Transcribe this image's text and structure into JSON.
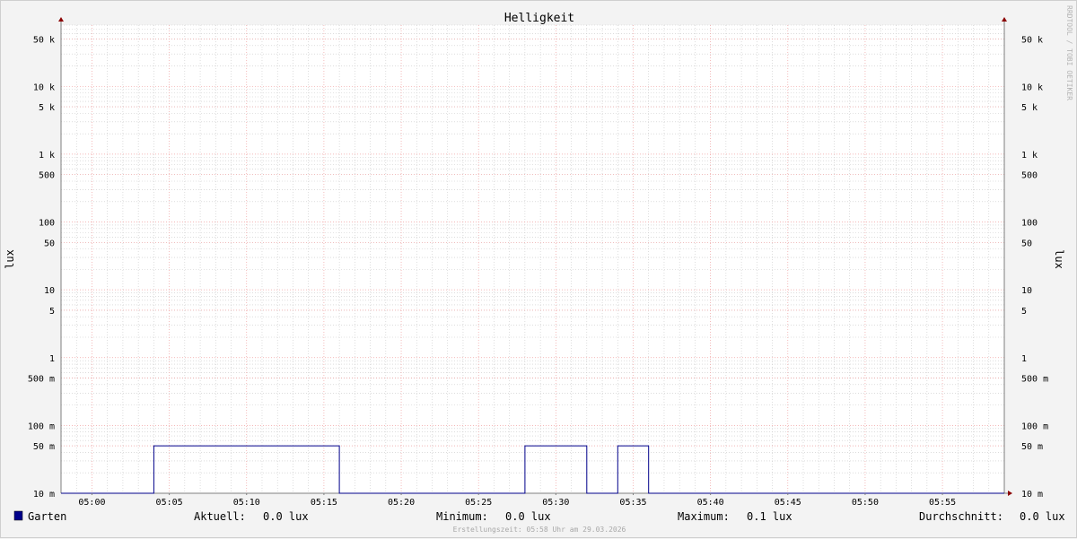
{
  "chart_data": {
    "type": "line",
    "title": "Helligkeit",
    "ylabel": "lux",
    "ylabel_right": "lux",
    "y_scale": "log",
    "ylim": [
      0.01,
      80000
    ],
    "xlim": [
      "04:58",
      "05:59"
    ],
    "x_ticks": [
      "05:00",
      "05:05",
      "05:10",
      "05:15",
      "05:20",
      "05:25",
      "05:30",
      "05:35",
      "05:40",
      "05:45",
      "05:50",
      "05:55"
    ],
    "y_ticks": [
      {
        "value": 50000,
        "label": "50 k"
      },
      {
        "value": 10000,
        "label": "10 k"
      },
      {
        "value": 5000,
        "label": "5 k"
      },
      {
        "value": 1000,
        "label": "1 k"
      },
      {
        "value": 500,
        "label": "500"
      },
      {
        "value": 100,
        "label": "100"
      },
      {
        "value": 50,
        "label": "50"
      },
      {
        "value": 10,
        "label": "10"
      },
      {
        "value": 5,
        "label": "5"
      },
      {
        "value": 1,
        "label": "1"
      },
      {
        "value": 0.5,
        "label": "500 m"
      },
      {
        "value": 0.1,
        "label": "100 m"
      },
      {
        "value": 0.05,
        "label": "50 m"
      },
      {
        "value": 0.01,
        "label": "10 m"
      }
    ],
    "grid": true,
    "series": [
      {
        "name": "Garten",
        "color": "#00008b",
        "points": [
          [
            "04:58",
            0.01
          ],
          [
            "05:04",
            0.01
          ],
          [
            "05:04",
            0.05
          ],
          [
            "05:16",
            0.05
          ],
          [
            "05:16",
            0.01
          ],
          [
            "05:28",
            0.01
          ],
          [
            "05:28",
            0.05
          ],
          [
            "05:32",
            0.05
          ],
          [
            "05:32",
            0.01
          ],
          [
            "05:34",
            0.01
          ],
          [
            "05:34",
            0.05
          ],
          [
            "05:36",
            0.05
          ],
          [
            "05:36",
            0.01
          ],
          [
            "05:59",
            0.01
          ]
        ]
      }
    ],
    "legend": {
      "placement": "bottom-left",
      "entries": [
        {
          "name": "Garten",
          "color": "#00008b"
        }
      ]
    }
  },
  "stats": {
    "current_label": "Aktuell:",
    "current_value": "0.0 lux",
    "min_label": "Minimum:",
    "min_value": "0.0 lux",
    "max_label": "Maximum:",
    "max_value": "0.1 lux",
    "avg_label": "Durchschnitt:",
    "avg_value": "0.0 lux"
  },
  "watermark": "RRDTOOL / TOBI OETIKER",
  "footer": "Erstellungszeit: 05:58 Uhr am 29.03.2026",
  "colors": {
    "background": "#f3f3f3",
    "plot": "#ffffff",
    "major_grid": "#f0a0a0",
    "minor_grid": "#c8c8c8",
    "axis": "#7f7f7f",
    "arrow": "#8b0000",
    "series": "#00008b"
  }
}
